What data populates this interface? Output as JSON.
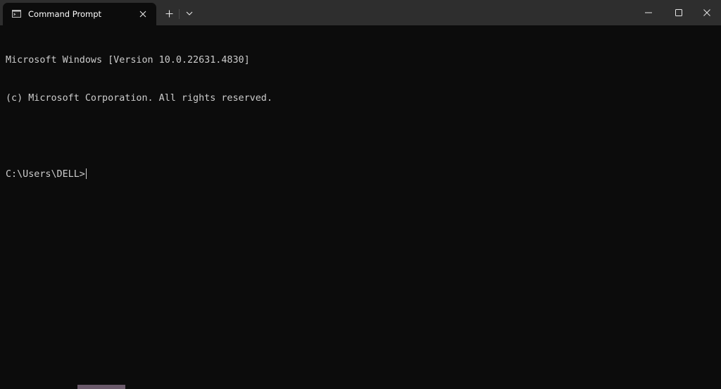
{
  "tab": {
    "title": "Command Prompt",
    "icon": "cmd-icon"
  },
  "titlebar": {
    "new_tab_icon": "plus-icon",
    "dropdown_icon": "chevron-down-icon",
    "minimize_icon": "minimize-icon",
    "maximize_icon": "maximize-icon",
    "close_icon": "close-icon"
  },
  "console": {
    "lines": [
      "Microsoft Windows [Version 10.0.22631.4830]",
      "(c) Microsoft Corporation. All rights reserved.",
      "",
      "C:\\Users\\DELL>"
    ]
  }
}
